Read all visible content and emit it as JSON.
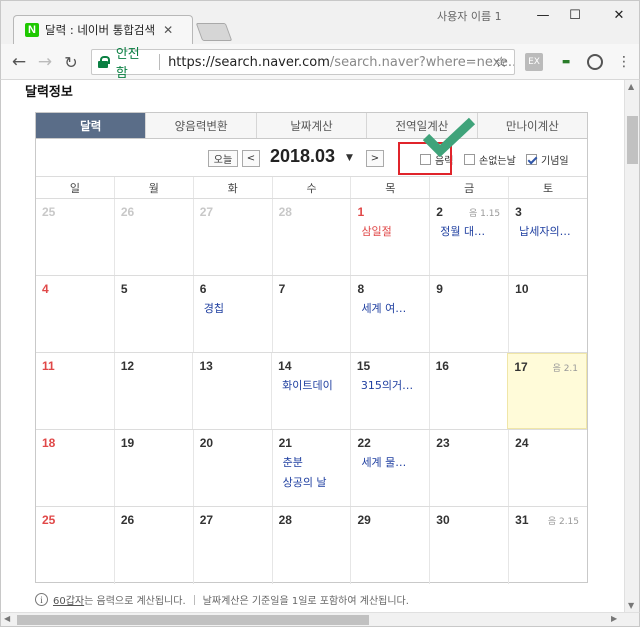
{
  "browser": {
    "tab_title": "달력 : 네이버 통합검색",
    "user_name": "사용자 이름 1",
    "secure_label": "안전함",
    "url_host": "https://search.naver.com",
    "url_rest": "/search.naver?where=nexe...",
    "logo_letter": "N",
    "ext_ex_label": "EX"
  },
  "page": {
    "section_title": "달력정보",
    "tabs": [
      {
        "label": "달력",
        "active": true
      },
      {
        "label": "양음력변환",
        "active": false
      },
      {
        "label": "날짜계산",
        "active": false
      },
      {
        "label": "전역일계산",
        "active": false
      },
      {
        "label": "만나이계산",
        "active": false
      }
    ],
    "today_button": "오늘",
    "prev_button": "<",
    "next_button": ">",
    "month_title": "2018.03",
    "options": {
      "lunar": {
        "label": "음력",
        "checked": false
      },
      "sonless": {
        "label": "손없는날",
        "checked": false
      },
      "memorial": {
        "label": "기념일",
        "checked": true
      }
    },
    "weekdays": [
      "일",
      "월",
      "화",
      "수",
      "목",
      "금",
      "토"
    ],
    "weeks": [
      [
        {
          "num": "25",
          "other": true
        },
        {
          "num": "26",
          "other": true
        },
        {
          "num": "27",
          "other": true
        },
        {
          "num": "28",
          "other": true
        },
        {
          "num": "1",
          "holiday": true,
          "events": [
            {
              "text": "삼일절",
              "red": true
            }
          ]
        },
        {
          "num": "2",
          "lunar": "음 1.15",
          "events": [
            {
              "text": "정월 대…"
            }
          ]
        },
        {
          "num": "3",
          "events": [
            {
              "text": "납세자의…"
            }
          ]
        }
      ],
      [
        {
          "num": "4",
          "sun": true
        },
        {
          "num": "5"
        },
        {
          "num": "6",
          "events": [
            {
              "text": "경칩"
            }
          ]
        },
        {
          "num": "7"
        },
        {
          "num": "8",
          "events": [
            {
              "text": "세계 여…"
            }
          ]
        },
        {
          "num": "9"
        },
        {
          "num": "10"
        }
      ],
      [
        {
          "num": "11",
          "sun": true
        },
        {
          "num": "12"
        },
        {
          "num": "13"
        },
        {
          "num": "14",
          "events": [
            {
              "text": "화이트데이"
            }
          ]
        },
        {
          "num": "15",
          "events": [
            {
              "text": "315의거…"
            }
          ]
        },
        {
          "num": "16"
        },
        {
          "num": "17",
          "today": true,
          "lunar": "음 2.1"
        }
      ],
      [
        {
          "num": "18",
          "sun": true
        },
        {
          "num": "19"
        },
        {
          "num": "20"
        },
        {
          "num": "21",
          "events": [
            {
              "text": "춘분"
            },
            {
              "text": "상공의 날"
            }
          ]
        },
        {
          "num": "22",
          "events": [
            {
              "text": "세계 물…"
            }
          ]
        },
        {
          "num": "23"
        },
        {
          "num": "24"
        }
      ],
      [
        {
          "num": "25",
          "sun": true
        },
        {
          "num": "26"
        },
        {
          "num": "27"
        },
        {
          "num": "28"
        },
        {
          "num": "29"
        },
        {
          "num": "30"
        },
        {
          "num": "31",
          "lunar": "음 2.15"
        }
      ]
    ],
    "footnote": {
      "icon_glyph": "i",
      "link_text": "60갑자",
      "text1": "는 음력으로 계산됩니다.",
      "text2": "날짜계산은 기준일을 1일로 포함하여 계산됩니다."
    }
  },
  "colors": {
    "active_tab": "#5a6d88",
    "holiday": "#e04848",
    "event": "#1f3fa0",
    "today_bg": "#fffbd9",
    "highlight_box": "#e0242b",
    "big_check": "#3fa37a"
  }
}
